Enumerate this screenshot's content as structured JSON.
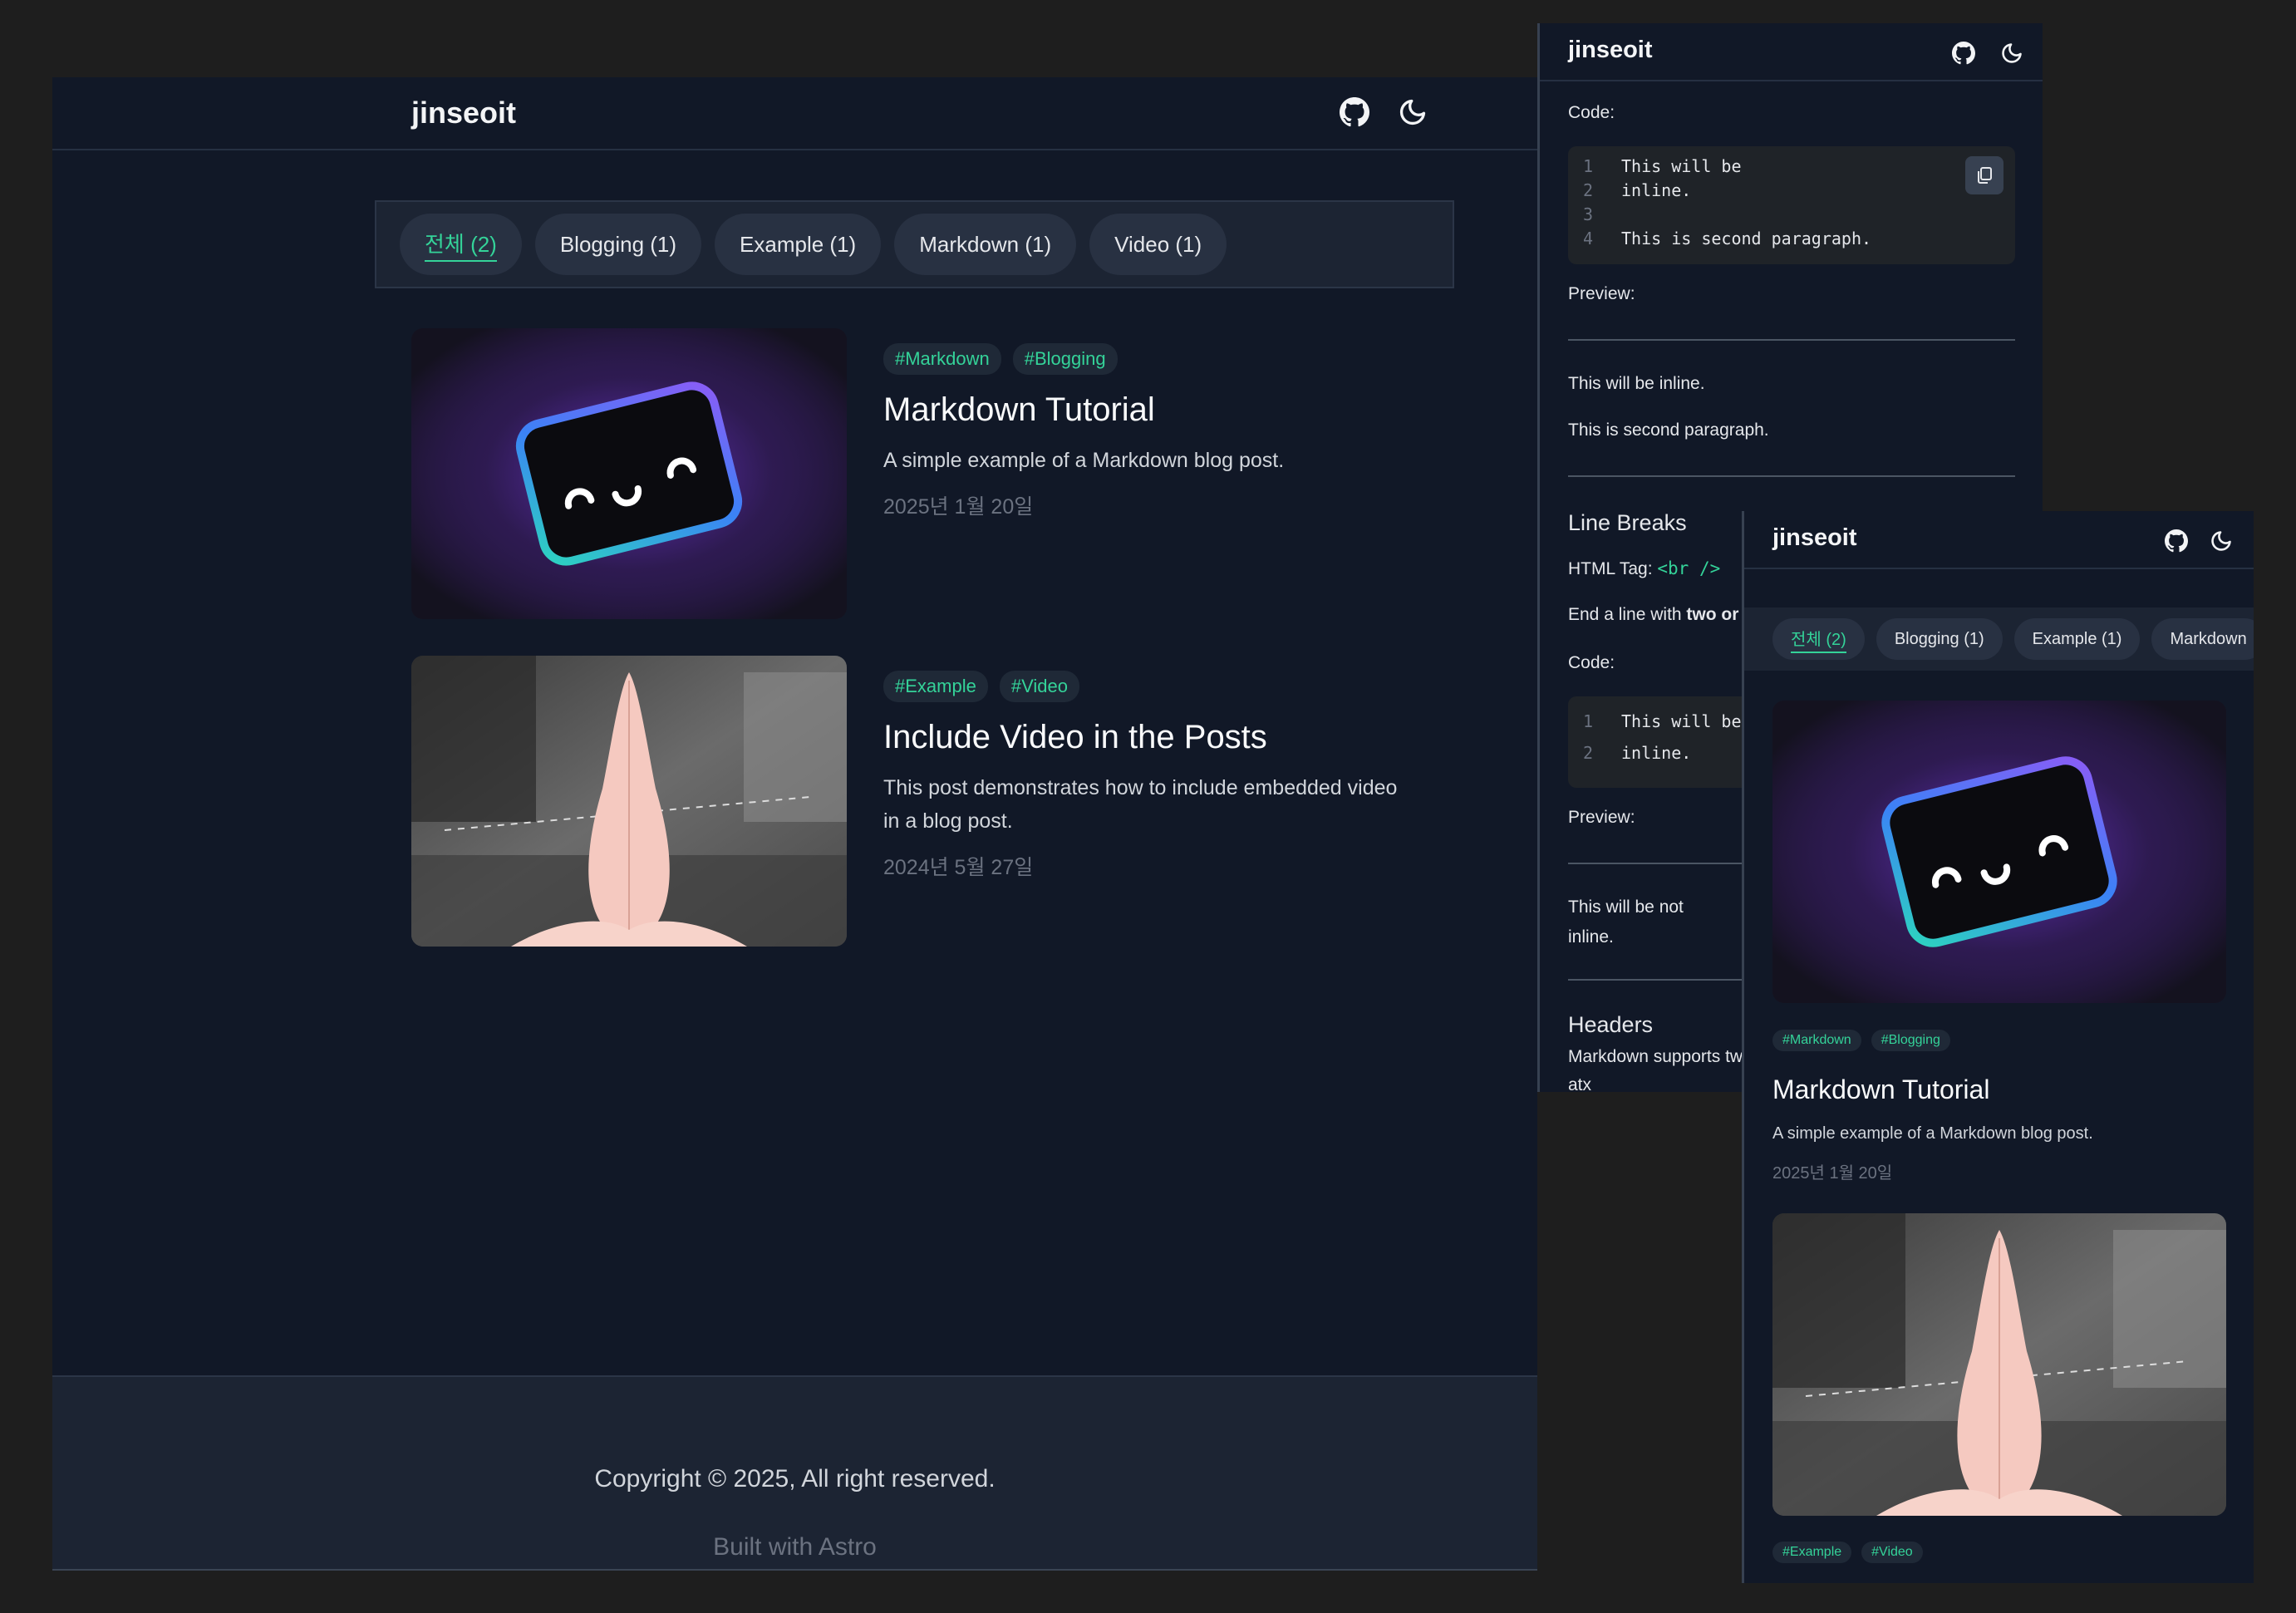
{
  "main": {
    "logo": "jinseoit",
    "tabs": [
      {
        "label": "전체 (2)",
        "active": true
      },
      {
        "label": "Blogging (1)"
      },
      {
        "label": "Example (1)"
      },
      {
        "label": "Markdown (1)"
      },
      {
        "label": "Video (1)"
      }
    ],
    "posts": [
      {
        "tags": [
          "#Markdown",
          "#Blogging"
        ],
        "title": "Markdown Tutorial",
        "desc": "A simple example of a Markdown blog post.",
        "date": "2025년 1월 20일"
      },
      {
        "tags": [
          "#Example",
          "#Video"
        ],
        "title": "Include Video in the Posts",
        "desc": "This post demonstrates how to include embedded video in a blog post.",
        "date": "2024년 5월 27일"
      }
    ],
    "footer": {
      "copyright": "Copyright © 2025, All right reserved.",
      "built": "Built with Astro"
    }
  },
  "article": {
    "logo": "jinseoit",
    "code_label": "Code:",
    "code1": [
      {
        "n": "1",
        "t": "This will be"
      },
      {
        "n": "2",
        "t": "inline."
      },
      {
        "n": "3",
        "t": ""
      },
      {
        "n": "4",
        "t": "This is second paragraph."
      }
    ],
    "preview_label": "Preview:",
    "preview1_line1": "This will be inline.",
    "preview1_line2": "This is second paragraph.",
    "line_breaks_heading": "Line Breaks",
    "html_tag_prefix": "HTML Tag: ",
    "html_tag_code": "<br />",
    "end_line_prefix": "End a line with ",
    "end_line_bold": "two or",
    "code2_label": "Code:",
    "code2": [
      {
        "n": "1",
        "t": "This will be"
      },
      {
        "n": "2",
        "t": "inline."
      }
    ],
    "preview2_label": "Preview:",
    "preview2_line1": "This will be not",
    "preview2_line2": "inline.",
    "headers_heading": "Headers",
    "headers_text": "Markdown supports two",
    "headers_text2": "atx"
  },
  "mobile": {
    "logo": "jinseoit",
    "tabs": [
      {
        "label": "전체 (2)",
        "active": true
      },
      {
        "label": "Blogging (1)"
      },
      {
        "label": "Example (1)"
      },
      {
        "label": "Markdown"
      }
    ],
    "post1": {
      "tags": [
        "#Markdown",
        "#Blogging"
      ],
      "title": "Markdown Tutorial",
      "desc": "A simple example of a Markdown blog post.",
      "date": "2025년 1월 20일"
    },
    "post2": {
      "tags": [
        "#Example",
        "#Video"
      ]
    }
  },
  "colors": {
    "accent": "#34d399",
    "background": "#111827",
    "surface": "#1c2433"
  },
  "icons": [
    "github-icon",
    "moon-icon",
    "copy-icon"
  ]
}
